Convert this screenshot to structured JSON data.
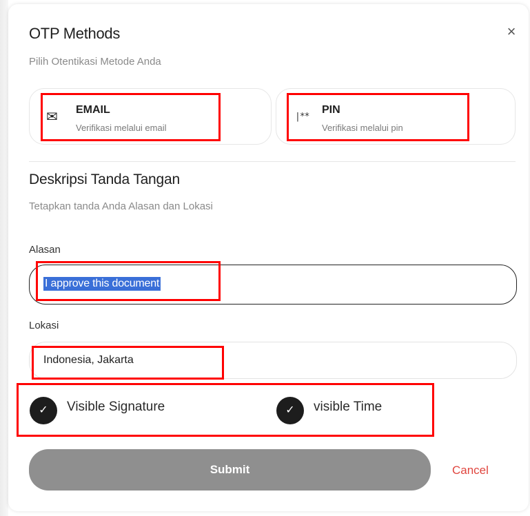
{
  "modal": {
    "title": "OTP Methods",
    "subtitle": "Pilih Otentikasi Metode Anda",
    "close_label": "×"
  },
  "methods": [
    {
      "name": "EMAIL",
      "description": "Verifikasi melalui email",
      "icon": "envelope-icon",
      "icon_glyph": "✉"
    },
    {
      "name": "PIN",
      "description": "Verifikasi melalui pin",
      "icon": "pin-icon",
      "icon_glyph": "|**"
    }
  ],
  "signature": {
    "title": "Deskripsi Tanda Tangan",
    "subtitle": "Tetapkan tanda Anda Alasan dan Lokasi",
    "alasan_label": "Alasan",
    "alasan_value": "I approve this document",
    "lokasi_label": "Lokasi",
    "lokasi_value": "Indonesia, Jakarta"
  },
  "options": [
    {
      "label": "Visible Signature",
      "checked": true
    },
    {
      "label": "visible Time",
      "checked": true
    }
  ],
  "actions": {
    "submit_label": "Submit",
    "cancel_label": "Cancel"
  },
  "colors": {
    "submit_bg": "#8f8f8f",
    "cancel_text": "#e0463f",
    "highlight": "#ff0000",
    "selection": "#3a6fd8"
  }
}
